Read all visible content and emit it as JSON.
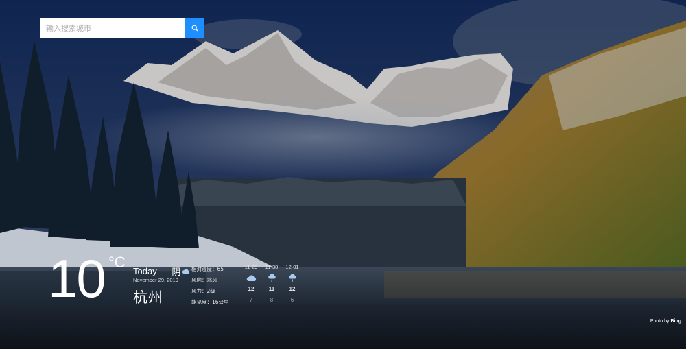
{
  "search": {
    "placeholder": "输入搜索城市",
    "button_icon": "search-icon"
  },
  "weather": {
    "temperature": "10",
    "unit": "°C",
    "today_label": "Today",
    "separator": "-",
    "condition": "阴",
    "condition_icon": "cloud-icon",
    "date": "November 29, 2019",
    "city": "杭州",
    "details": [
      {
        "label": "相对湿度：65"
      },
      {
        "label": "风向：北风"
      },
      {
        "label": "风力：2级"
      },
      {
        "label": "能见度：16公里"
      }
    ]
  },
  "forecast": [
    {
      "date": "11-29",
      "icon": "cloud-icon",
      "high": "12",
      "low": "7"
    },
    {
      "date": "11-30",
      "icon": "rain-cloud-icon",
      "high": "11",
      "low": "8"
    },
    {
      "date": "12-01",
      "icon": "rain-cloud-icon",
      "high": "12",
      "low": "6"
    }
  ],
  "credit": {
    "prefix": "Photo by",
    "source": "Bing"
  },
  "colors": {
    "accent": "#1e8fff",
    "icon": "#a9cbf0"
  }
}
